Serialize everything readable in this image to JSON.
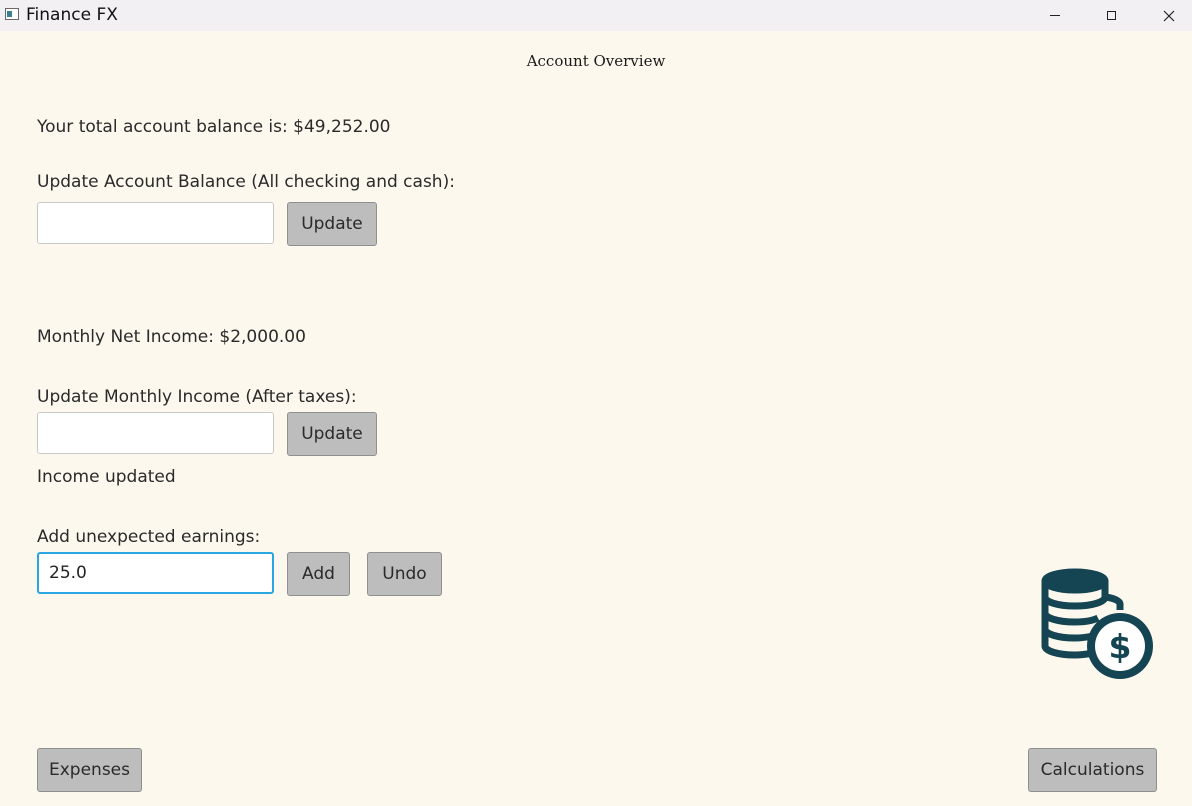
{
  "window": {
    "title": "Finance FX"
  },
  "page": {
    "title": "Account Overview"
  },
  "balance": {
    "text": "Your total account balance is: $49,252.00",
    "update_label": "Update Account Balance (All checking and cash):",
    "input_value": "",
    "update_button": "Update"
  },
  "income": {
    "text": "Monthly Net Income: $2,000.00",
    "update_label": "Update Monthly Income (After taxes):",
    "input_value": "",
    "update_button": "Update",
    "status": "Income updated"
  },
  "earnings": {
    "label": "Add unexpected earnings:",
    "input_value": "25.0",
    "add_button": "Add",
    "undo_button": "Undo"
  },
  "footer": {
    "expenses_button": "Expenses",
    "calculations_button": "Calculations"
  },
  "icons": {
    "decoration": "coins-dollar-icon",
    "color": "#154452"
  },
  "colors": {
    "background": "#fdf8ee",
    "button": "#bdbdbd",
    "focus": "#2aa7e0"
  }
}
